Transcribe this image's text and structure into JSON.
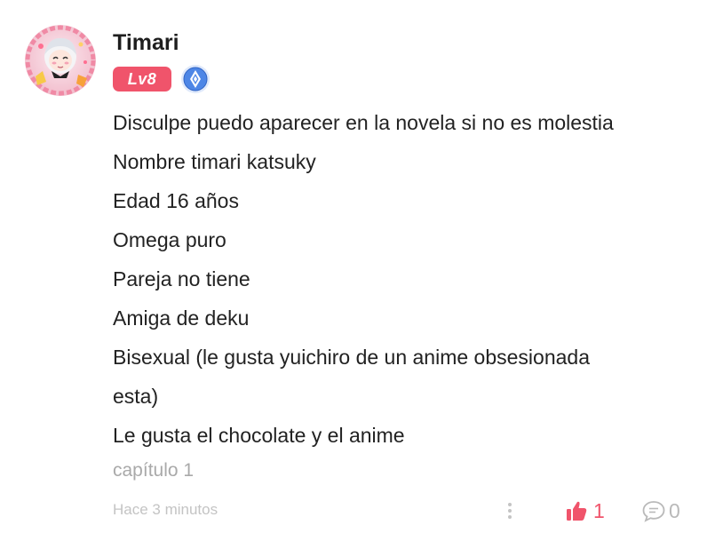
{
  "comment": {
    "author": {
      "username": "Timari",
      "level_badge": "Lv8",
      "badge_color": "#f0546b",
      "curator_icon": "curator-badge-icon"
    },
    "lines": [
      "Disculpe puedo aparecer en la novela si no es molestia",
      "Nombre timari katsuky",
      "Edad 16 años",
      "Omega puro",
      "Pareja no tiene",
      "Amiga de deku",
      "Bisexual (le gusta yuichiro de un anime obsesionada",
      "esta)",
      "Le gusta el chocolate y el anime"
    ],
    "chapter_link": "capítulo 1",
    "timestamp": "Hace 3 minutos",
    "actions": {
      "more_icon": "more-vertical-icon",
      "like_icon": "thumbs-up-icon",
      "like_count": "1",
      "like_color": "#f0546b",
      "comment_icon": "speech-bubble-icon",
      "comment_count": "0"
    }
  }
}
